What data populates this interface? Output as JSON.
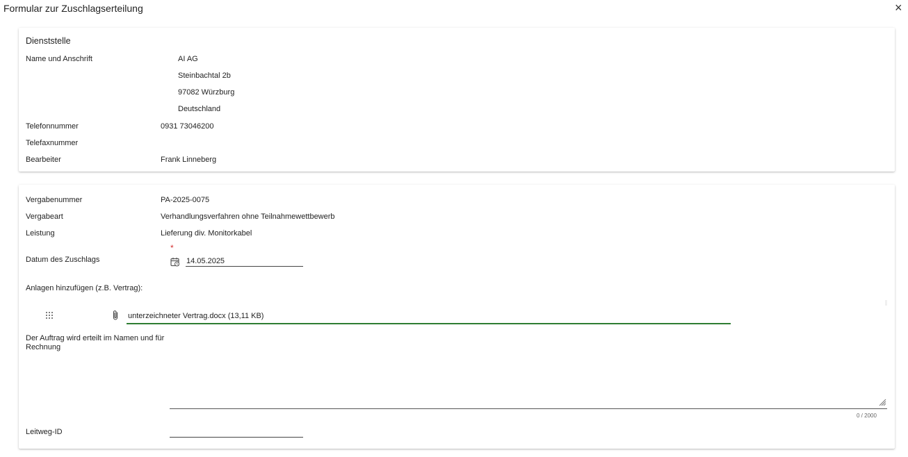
{
  "dialog": {
    "title": "Formular zur Zuschlagserteilung",
    "close_symbol": "×"
  },
  "dienststelle": {
    "section_title": "Dienststelle",
    "name_label": "Name und Anschrift",
    "address": [
      "AI AG",
      "Steinbachtal 2b",
      "97082 Würzburg",
      "Deutschland"
    ],
    "phone_label": "Telefonnummer",
    "phone": "0931 73046200",
    "fax_label": "Telefaxnummer",
    "fax": "",
    "handler_label": "Bearbeiter",
    "handler": "Frank Linneberg"
  },
  "vergabe": {
    "number_label": "Vergabenummer",
    "number": "PA-2025-0075",
    "type_label": "Vergabeart",
    "type": "Verhandlungsverfahren ohne Teilnahmewettbewerb",
    "service_label": "Leistung",
    "service": "Lieferung div. Monitorkabel",
    "date_required_mark": "*",
    "date_label": "Datum des Zuschlags",
    "date": "14.05.2025",
    "attachments_label": "Anlagen hinzufügen (z.B. Vertrag):",
    "attachment": "unterzeichneter Vertrag.docx (13,11 KB)",
    "order_label": "Der Auftrag wird erteilt im Namen und für Rechnung",
    "order_value": "",
    "order_counter": "0 / 2000",
    "leitweg_label": "Leitweg-ID",
    "leitweg_value": ""
  },
  "colors": {
    "accent_green": "#2e7d32",
    "required_red": "#d32f2f"
  }
}
